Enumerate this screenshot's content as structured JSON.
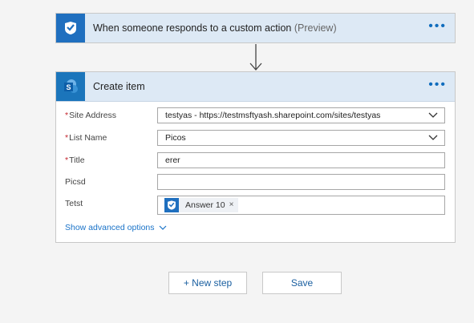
{
  "trigger": {
    "icon": "flow-check-icon",
    "title": "When someone responds to a custom action",
    "preview": "(Preview)",
    "more": "•••"
  },
  "action": {
    "icon": "sharepoint-icon",
    "title": "Create item",
    "more": "•••",
    "fields": [
      {
        "label": "Site Address",
        "required": "*",
        "value": "testyas - https://testmsftyash.sharepoint.com/sites/testyas",
        "type": "dropdown"
      },
      {
        "label": "List Name",
        "required": "*",
        "value": "Picos",
        "type": "dropdown"
      },
      {
        "label": "Title",
        "required": "*",
        "value": "erer",
        "type": "text"
      },
      {
        "label": "Picsd",
        "required": "",
        "value": "",
        "type": "text"
      },
      {
        "label": "Tetst",
        "required": "",
        "token": "Answer 10",
        "token_close": "×",
        "type": "token"
      }
    ],
    "advanced": "Show advanced options"
  },
  "buttons": {
    "new_step": "+ New step",
    "save": "Save"
  },
  "colors": {
    "accent": "#0f6cbd",
    "header_bg": "#dde9f5",
    "required": "#c4262e",
    "link": "#1a73c8"
  }
}
